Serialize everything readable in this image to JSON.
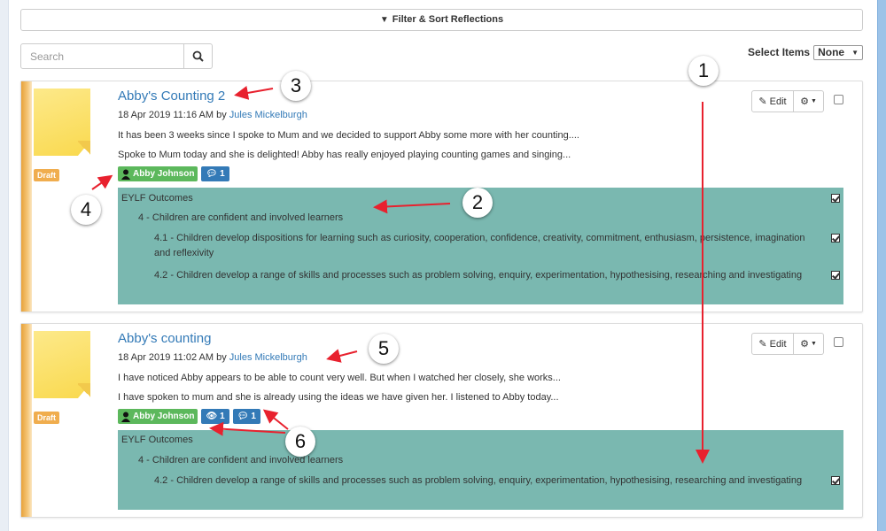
{
  "filter_bar": {
    "label": "Filter & Sort Reflections",
    "icon": "filter-icon"
  },
  "search": {
    "placeholder": "Search",
    "icon": "search-icon"
  },
  "select_items": {
    "label": "Select Items",
    "value": "None"
  },
  "cards": [
    {
      "title": "Abby's Counting 2",
      "date": "18 Apr 2019 11:16 AM by",
      "author": "Jules Mickelburgh",
      "line1": "It has been 3 weeks since I spoke to Mum and we decided to support Abby some more with her counting....",
      "line2": "Spoke to Mum today and she is delighted! Abby has really enjoyed playing counting games and singing...",
      "status": "Draft",
      "child_tag": "Abby Johnson",
      "comment_count": "1",
      "edit_label": "Edit",
      "outcomes": {
        "heading": "EYLF Outcomes",
        "sub": "4 - Children are confident and involved learners",
        "items": [
          "4.1 - Children develop dispositions for learning such as curiosity, cooperation, confidence, creativity, commitment, enthusiasm, persistence, imagination and reflexivity",
          "4.2 - Children develop a range of skills and processes such as problem solving, enquiry, experimentation, hypothesising, researching and investigating"
        ]
      }
    },
    {
      "title": "Abby's counting",
      "date": "18 Apr 2019 11:02 AM by",
      "author": "Jules Mickelburgh",
      "line1": "I have noticed Abby appears to be able to count very well. But when I watched her closely, she works...",
      "line2": "I have spoken to mum and she is already using the ideas we have given her. I listened to Abby today...",
      "status": "Draft",
      "child_tag": "Abby Johnson",
      "view_count": "1",
      "comment_count": "1",
      "edit_label": "Edit",
      "outcomes": {
        "heading": "EYLF Outcomes",
        "sub": "4 - Children are confident and involved learners",
        "items": [
          "4.2 - Children develop a range of skills and processes such as problem solving, enquiry, experimentation, hypothesising, researching and investigating"
        ]
      }
    }
  ],
  "annotations": [
    "1",
    "2",
    "3",
    "4",
    "5",
    "6"
  ],
  "colors": {
    "link": "#337ab7",
    "outcomes_bg": "#7ab8b0",
    "draft": "#f0ad4e",
    "child_tag": "#5cb85c",
    "arrow": "#e8212e"
  }
}
